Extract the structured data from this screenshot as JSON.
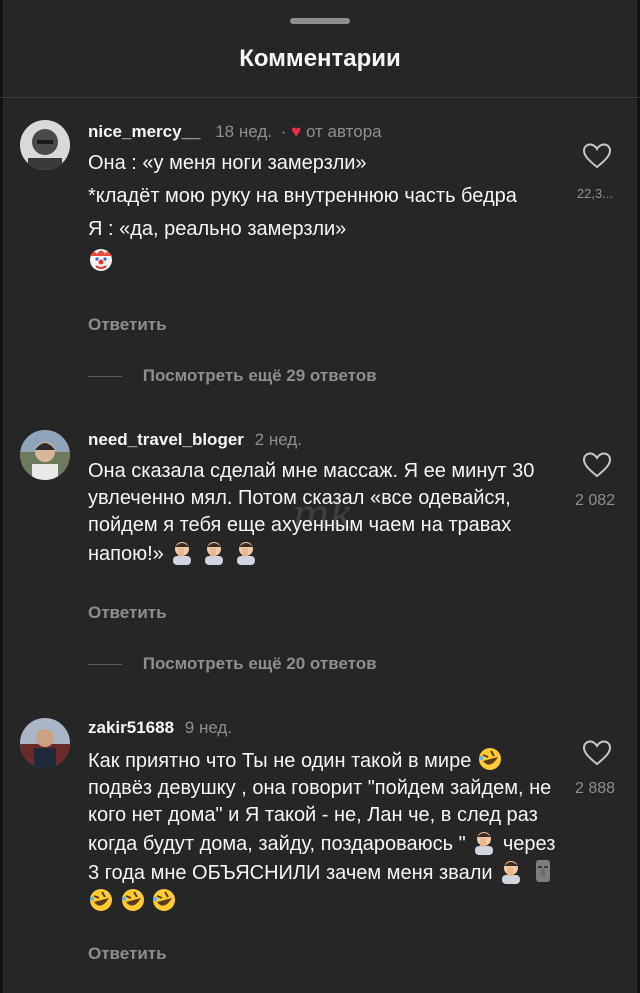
{
  "header": {
    "title": "Комментарии"
  },
  "comments": [
    {
      "user": "nice_mercy__",
      "time": "18 нед.",
      "dot": "·",
      "author_like": "от автора",
      "lines": [
        "Она : «у меня ноги замерзли»",
        "*кладёт мою руку на внутреннюю часть бедра",
        "Я : «да, реально замерзли»"
      ],
      "emoji": "clown-face",
      "likes": "22,3...",
      "reply": "Ответить",
      "more": "Посмотреть ещё 29 ответов"
    },
    {
      "user": "need_travel_bloger",
      "time": "2 нед.",
      "text": "Она сказала сделай мне массаж. Я ее минут 30 увлеченно мял. Потом сказал «все одевайся, пойдем я тебя еще ахуенным чаем на травах напою!»",
      "emoji": "man-facepalming",
      "likes": "2 082",
      "reply": "Ответить",
      "more": "Посмотреть ещё 20 ответов"
    },
    {
      "user": "zakir51688",
      "time": "9 нед.",
      "text_a": "Как приятно что Ты не один такой в мире",
      "text_b": "подвёз девушку , она говорит \"пойдем зайдем, не кого нет дома\" и Я такой - не, Лан че, в след раз когда будут дома, зайду, поздароваюсь \"",
      "text_c": "через 3 года мне ОБЪЯСНИЛИ зачем меня звали",
      "emoji": "rolling-on-floor-laughing",
      "likes": "2 888",
      "reply": "Ответить"
    }
  ],
  "watermark": "mk"
}
